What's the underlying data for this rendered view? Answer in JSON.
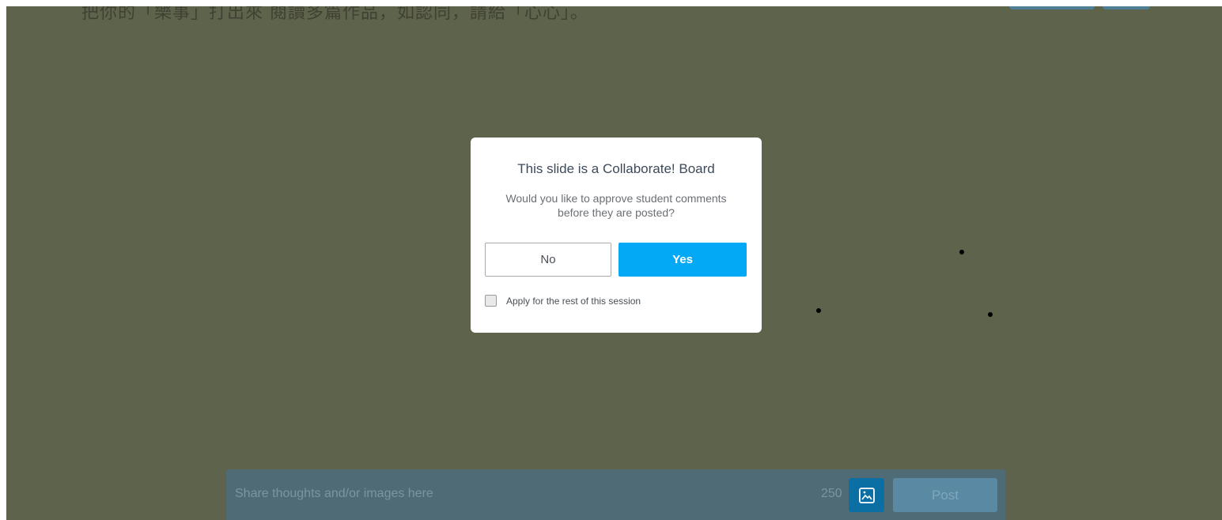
{
  "slide": {
    "text": "把你的「樂事」打出來 閱讀多篇作品，如認同，請給「心心」。"
  },
  "dialog": {
    "title": "This slide is a Collaborate! Board",
    "message": "Would you like to approve student comments before they are posted?",
    "no_label": "No",
    "yes_label": "Yes",
    "apply_label": "Apply for the rest of this session",
    "apply_checked": false
  },
  "composer": {
    "placeholder": "Share thoughts and/or images here",
    "char_count": "250",
    "post_label": "Post",
    "image_icon": "image-icon"
  },
  "colors": {
    "overlay": "#5e634b",
    "primary": "#03a9f4",
    "composer_bg": "#4f6c76",
    "image_button": "#0c6fa3"
  }
}
